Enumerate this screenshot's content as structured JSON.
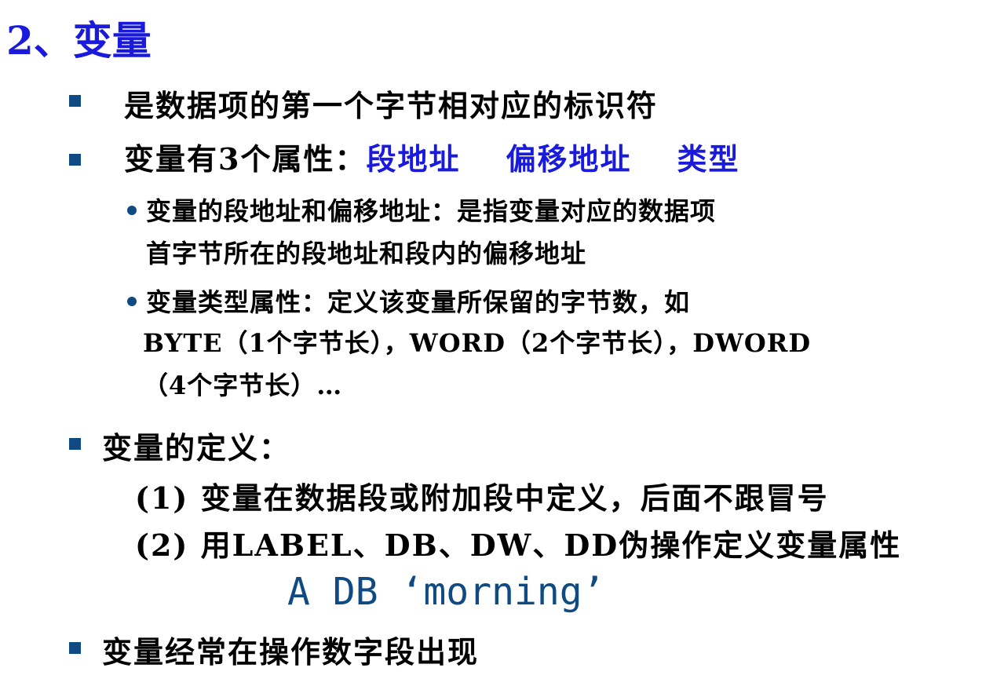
{
  "title": "2、变量",
  "bullets": {
    "b1": "是数据项的第一个字节相对应的标识符",
    "b2_prefix": "变量有3个属性：",
    "b2_attr1": "段地址",
    "b2_attr2": "偏移地址",
    "b2_attr3": "类型",
    "s1_line1": "变量的段地址和偏移地址：是指变量对应的数据项",
    "s1_line2": "首字节所在的段地址和段内的偏移地址",
    "s2_line1": "变量类型属性：定义该变量所保留的字节数，如",
    "s2_line2": "BYTE（1个字节长），WORD（2个字节长），DWORD",
    "s2_line3": "（4个字节长）…",
    "b3": "变量的定义：",
    "d1": "(1) 变量在数据段或附加段中定义，后面不跟冒号",
    "d2": "(2) 用LABEL、DB、DW、DD伪操作定义变量属性",
    "code": "A   DB  ‘morning’",
    "b4": "变量经常在操作数字段出现"
  },
  "colors": {
    "title": "#1a1adc",
    "highlight": "#1a1adc",
    "bullet": "#0f4a82",
    "code": "#0f4a82"
  }
}
